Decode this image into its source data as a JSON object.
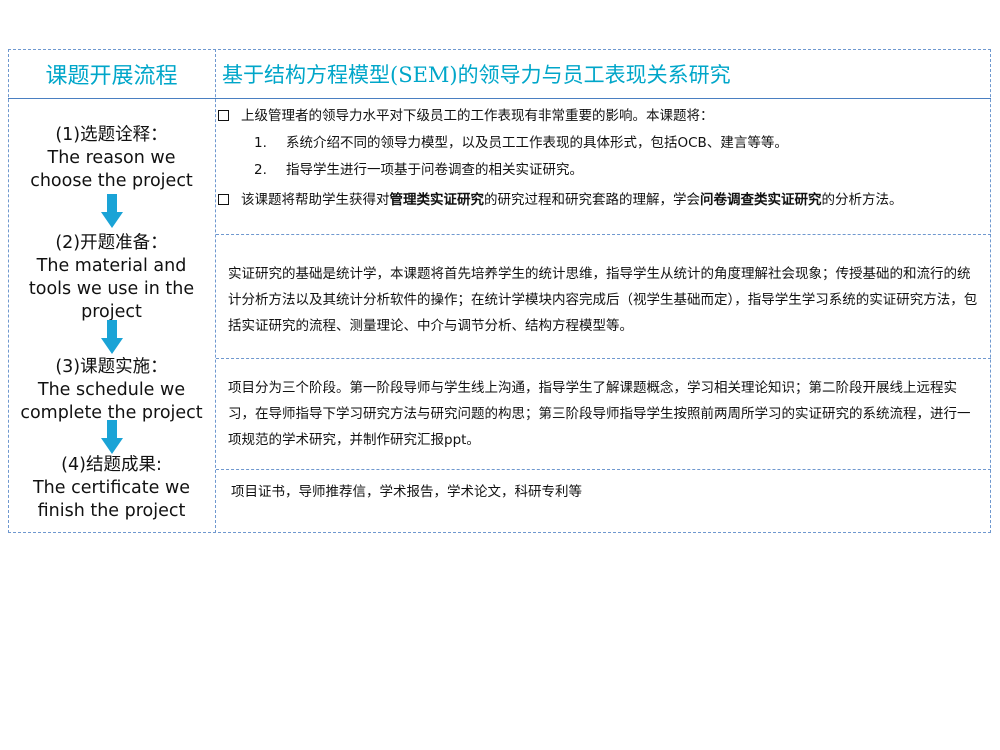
{
  "header": {
    "left_title": "课题开展流程",
    "right_title": "基于结构方程模型(SEM)的领导力与员工表现关系研究"
  },
  "steps": [
    {
      "cn": "(1)选题诠释：",
      "en": [
        "The reason we",
        "choose the project"
      ]
    },
    {
      "cn": "(2)开题准备：",
      "en": [
        "The material and",
        "tools we use in the",
        "project"
      ]
    },
    {
      "cn": "(3)课题实施：",
      "en": [
        "The schedule we",
        "complete the project"
      ]
    },
    {
      "cn": "(4)结题成果:",
      "en": [
        "The certificate we",
        "finish the project"
      ]
    }
  ],
  "section1": {
    "bullet1": "上级管理者的领导力水平对下级员工的工作表现有非常重要的影响。本课题将：",
    "items": [
      {
        "num": "1.",
        "text": "系统介绍不同的领导力模型，以及员工工作表现的具体形式，包括OCB、建言等等。"
      },
      {
        "num": "2.",
        "text": "指导学生进行一项基于问卷调查的相关实证研究。"
      }
    ],
    "bullet2": {
      "part1": "该课题将帮助学生获得对",
      "bold1": "管理类实证研究",
      "part2": "的研究过程和研究套路的理解，学会",
      "bold2": "问卷调查类实证研究",
      "part3": "的分析方法。"
    }
  },
  "section2": {
    "text": "实证研究的基础是统计学，本课题将首先培养学生的统计思维，指导学生从统计的角度理解社会现象；传授基础的和流行的统计分析方法以及其统计分析软件的操作；在统计学模块内容完成后（视学生基础而定），指导学生学习系统的实证研究方法，包括实证研究的流程、测量理论、中介与调节分析、结构方程模型等。"
  },
  "section3": {
    "text": "项目分为三个阶段。第一阶段导师与学生线上沟通，指导学生了解课题概念，学习相关理论知识；第二阶段开展线上远程实习，在导师指导下学习研究方法与研究问题的构思；第三阶段导师指导学生按照前两周所学习的实证研究的系统流程，进行一项规范的学术研究，并制作研究汇报ppt。"
  },
  "section4": {
    "text": "项目证书，导师推荐信，学术报告，学术论文，科研专利等"
  },
  "colors": {
    "accent": "#00a6c9",
    "border": "#6f98cf",
    "arrow": "#1aa3d6"
  },
  "icons": {
    "bullet": "square-bullet-icon",
    "arrow": "down-arrow-icon"
  }
}
